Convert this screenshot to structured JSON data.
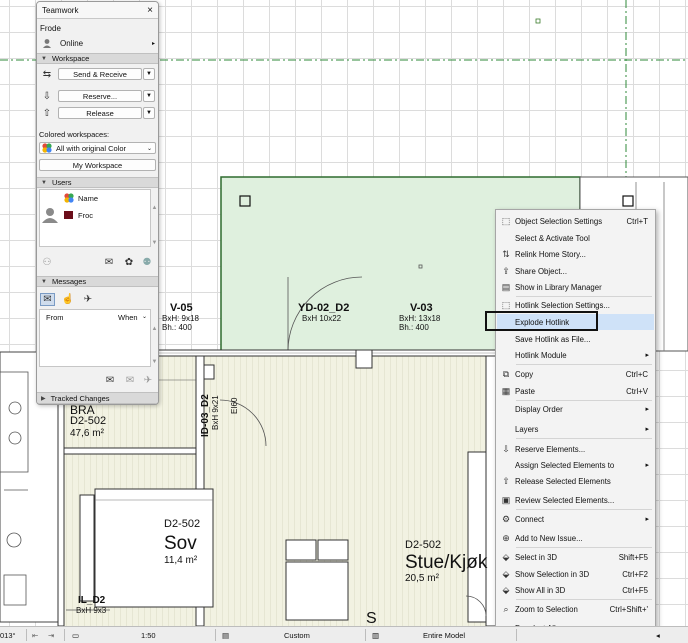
{
  "teamwork": {
    "title": "Teamwork",
    "close_icon": "×",
    "user_name": "Frode",
    "status": "Online",
    "workspace_header": "Workspace",
    "send_receive": "Send & Receive",
    "reserve": "Reserve...",
    "release": "Release",
    "colored_workspaces_label": "Colored workspaces:",
    "color_mode": "All with original Color",
    "my_workspace": "My Workspace",
    "users_header": "Users",
    "users_col_name": "Name",
    "user_entry": "Froc",
    "messages_header": "Messages",
    "messages_col_from": "From",
    "messages_col_when": "When",
    "tracked_changes_header": "Tracked Changes",
    "colors": {
      "user_swatch": "#6b0d1a",
      "header_bg": "#d9d9d9"
    }
  },
  "plan": {
    "labels": {
      "v05_code": "V-05",
      "v05_dim1": "BxH:  9x18",
      "v05_dim2": "Bh.:    400",
      "yd02_code": "YD-02_D2",
      "yd02_dim": "BxH   10x22",
      "v03_code": "V-03",
      "v03_dim1": "BxH:  13x18",
      "v03_dim2": "Bh.:    400",
      "bra_name": "BRA",
      "bra_code": "D2-502",
      "bra_area": "47,6 m²",
      "id03_code": "ID-03_D2",
      "id03_dim": "BxH 9x21",
      "ei60": "EI60",
      "sov_code": "D2-502",
      "sov_name": "Sov",
      "sov_area": "11,4 m²",
      "stue_code": "D2-502",
      "stue_name": "Stue/Kjøk",
      "stue_area": "20,5 m²",
      "il_code": "IL_D2",
      "il_dim": "BxH  9x3",
      "s_partial": "S"
    },
    "colors": {
      "zone_fill": "#dff0de",
      "zone_border": "#2f6b2f",
      "floor_hatch": "#eeeedb"
    }
  },
  "context_menu": {
    "items": [
      {
        "icon": "⬚",
        "label": "Object Selection Settings",
        "shortcut": "Ctrl+T"
      },
      {
        "icon": "",
        "label": "Select & Activate Tool",
        "shortcut": ""
      },
      {
        "icon": "⇅",
        "label": "Relink Home Story...",
        "shortcut": ""
      },
      {
        "icon": "⇪",
        "label": "Share Object...",
        "shortcut": ""
      },
      {
        "icon": "▤",
        "label": "Show in Library Manager",
        "shortcut": ""
      },
      {
        "icon": "⬚",
        "label": "Hotlink Selection Settings...",
        "shortcut": ""
      },
      {
        "icon": "",
        "label": "Explode Hotlink",
        "shortcut": ""
      },
      {
        "icon": "",
        "label": "Save Hotlink as File...",
        "shortcut": ""
      },
      {
        "icon": "",
        "label": "Hotlink Module",
        "shortcut": ""
      },
      {
        "icon": "⧉",
        "label": "Copy",
        "shortcut": "Ctrl+C"
      },
      {
        "icon": "▦",
        "label": "Paste",
        "shortcut": "Ctrl+V"
      },
      {
        "icon": "",
        "label": "Display Order",
        "shortcut": ""
      },
      {
        "icon": "",
        "label": "Layers",
        "shortcut": ""
      },
      {
        "icon": "⇩",
        "label": "Reserve Elements...",
        "shortcut": ""
      },
      {
        "icon": "",
        "label": "Assign Selected Elements to",
        "shortcut": ""
      },
      {
        "icon": "⇧",
        "label": "Release Selected Elements",
        "shortcut": ""
      },
      {
        "icon": "▣",
        "label": "Review Selected Elements...",
        "shortcut": ""
      },
      {
        "icon": "⚙",
        "label": "Connect",
        "shortcut": ""
      },
      {
        "icon": "⊕",
        "label": "Add to New Issue...",
        "shortcut": ""
      },
      {
        "icon": "⬙",
        "label": "Select in 3D",
        "shortcut": "Shift+F5"
      },
      {
        "icon": "⬙",
        "label": "Show Selection in 3D",
        "shortcut": "Ctrl+F2"
      },
      {
        "icon": "⬙",
        "label": "Show All in 3D",
        "shortcut": "Ctrl+F5"
      },
      {
        "icon": "⌕",
        "label": "Zoom to Selection",
        "shortcut": "Ctrl+Shift+'"
      },
      {
        "icon": "",
        "label": "Deselect All",
        "shortcut": ""
      }
    ],
    "submenu_arrow": "▸"
  },
  "statusbar": {
    "view_partial": "013°",
    "scale": "1:50",
    "pen_set": "Custom",
    "model_filter": "Entire Model"
  }
}
